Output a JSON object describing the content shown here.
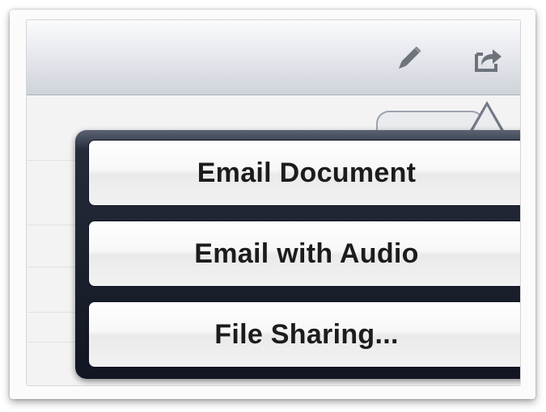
{
  "toolbar": {
    "icons": [
      "pencil-icon",
      "share-icon"
    ]
  },
  "popover": {
    "items": [
      {
        "label": "Email Document"
      },
      {
        "label": "Email with Audio"
      },
      {
        "label": "File Sharing..."
      }
    ]
  },
  "colors": {
    "popover_background": "#1a1f2c",
    "button_background": "#f7f7f7",
    "button_text": "#1c1c1c",
    "toolbar_top": "#fafbfd",
    "toolbar_bottom": "#cfd3da"
  }
}
